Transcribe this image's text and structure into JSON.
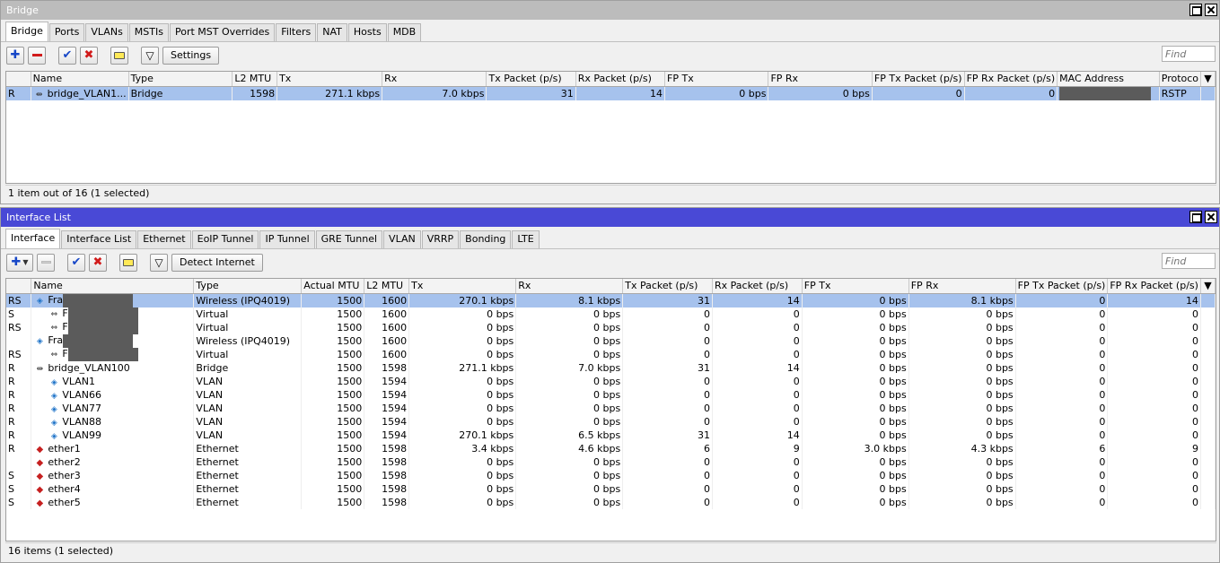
{
  "bridge_window": {
    "title": "Bridge",
    "tabs": [
      "Bridge",
      "Ports",
      "VLANs",
      "MSTIs",
      "Port MST Overrides",
      "Filters",
      "NAT",
      "Hosts",
      "MDB"
    ],
    "active_tab": "Bridge",
    "toolbar": {
      "settings_label": "Settings",
      "find_placeholder": "Find"
    },
    "columns": [
      "",
      "Name",
      "Type",
      "L2 MTU",
      "Tx",
      "Rx",
      "Tx Packet (p/s)",
      "Rx Packet (p/s)",
      "FP Tx",
      "FP Rx",
      "FP Tx Packet (p/s)",
      "FP Rx Packet (p/s)",
      "MAC Address",
      "Protoco"
    ],
    "rows": [
      {
        "flag": "R",
        "name": "bridge_VLAN1...",
        "type": "Bridge",
        "l2mtu": "1598",
        "tx": "271.1 kbps",
        "rx": "7.0 kbps",
        "txp": "31",
        "rxp": "14",
        "fptx": "0 bps",
        "fprx": "0 bps",
        "fptxp": "0",
        "fprxp": "0",
        "mac": "",
        "proto": "RSTP",
        "selected": true
      }
    ],
    "status": "1 item out of 16 (1 selected)"
  },
  "interface_window": {
    "title": "Interface List",
    "tabs": [
      "Interface",
      "Interface List",
      "Ethernet",
      "EoIP Tunnel",
      "IP Tunnel",
      "GRE Tunnel",
      "VLAN",
      "VRRP",
      "Bonding",
      "LTE"
    ],
    "active_tab": "Interface",
    "toolbar": {
      "detect_label": "Detect Internet",
      "find_placeholder": "Find"
    },
    "columns": [
      "",
      "Name",
      "Type",
      "Actual MTU",
      "L2 MTU",
      "Tx",
      "Rx",
      "Tx Packet (p/s)",
      "Rx Packet (p/s)",
      "FP Tx",
      "FP Rx",
      "FP Tx Packet (p/s)",
      "FP Rx Packet (p/s)"
    ],
    "rows": [
      {
        "flag": "RS",
        "icon": "wifi",
        "indent": 0,
        "name": "Fra",
        "type": "Wireless (IPQ4019)",
        "amtu": "1500",
        "l2mtu": "1600",
        "tx": "270.1 kbps",
        "rx": "8.1 kbps",
        "txp": "31",
        "rxp": "14",
        "fptx": "0 bps",
        "fprx": "8.1 kbps",
        "fptxp": "0",
        "fprxp": "14",
        "selected": true
      },
      {
        "flag": "S",
        "icon": "virtual",
        "indent": 1,
        "name": "F",
        "type": "Virtual",
        "amtu": "1500",
        "l2mtu": "1600",
        "tx": "0 bps",
        "rx": "0 bps",
        "txp": "0",
        "rxp": "0",
        "fptx": "0 bps",
        "fprx": "0 bps",
        "fptxp": "0",
        "fprxp": "0"
      },
      {
        "flag": "RS",
        "icon": "virtual",
        "indent": 1,
        "name": "F",
        "type": "Virtual",
        "amtu": "1500",
        "l2mtu": "1600",
        "tx": "0 bps",
        "rx": "0 bps",
        "txp": "0",
        "rxp": "0",
        "fptx": "0 bps",
        "fprx": "0 bps",
        "fptxp": "0",
        "fprxp": "0"
      },
      {
        "flag": "",
        "icon": "wifi",
        "indent": 0,
        "name": "Fra",
        "type": "Wireless (IPQ4019)",
        "amtu": "1500",
        "l2mtu": "1600",
        "tx": "0 bps",
        "rx": "0 bps",
        "txp": "0",
        "rxp": "0",
        "fptx": "0 bps",
        "fprx": "0 bps",
        "fptxp": "0",
        "fprxp": "0"
      },
      {
        "flag": "RS",
        "icon": "virtual",
        "indent": 1,
        "name": "F",
        "type": "Virtual",
        "amtu": "1500",
        "l2mtu": "1600",
        "tx": "0 bps",
        "rx": "0 bps",
        "txp": "0",
        "rxp": "0",
        "fptx": "0 bps",
        "fprx": "0 bps",
        "fptxp": "0",
        "fprxp": "0"
      },
      {
        "flag": "R",
        "icon": "bridge",
        "indent": 0,
        "name": "bridge_VLAN100",
        "type": "Bridge",
        "amtu": "1500",
        "l2mtu": "1598",
        "tx": "271.1 kbps",
        "rx": "7.0 kbps",
        "txp": "31",
        "rxp": "14",
        "fptx": "0 bps",
        "fprx": "0 bps",
        "fptxp": "0",
        "fprxp": "0"
      },
      {
        "flag": "R",
        "icon": "vlan",
        "indent": 1,
        "name": "VLAN1",
        "type": "VLAN",
        "amtu": "1500",
        "l2mtu": "1594",
        "tx": "0 bps",
        "rx": "0 bps",
        "txp": "0",
        "rxp": "0",
        "fptx": "0 bps",
        "fprx": "0 bps",
        "fptxp": "0",
        "fprxp": "0"
      },
      {
        "flag": "R",
        "icon": "vlan",
        "indent": 1,
        "name": "VLAN66",
        "type": "VLAN",
        "amtu": "1500",
        "l2mtu": "1594",
        "tx": "0 bps",
        "rx": "0 bps",
        "txp": "0",
        "rxp": "0",
        "fptx": "0 bps",
        "fprx": "0 bps",
        "fptxp": "0",
        "fprxp": "0"
      },
      {
        "flag": "R",
        "icon": "vlan",
        "indent": 1,
        "name": "VLAN77",
        "type": "VLAN",
        "amtu": "1500",
        "l2mtu": "1594",
        "tx": "0 bps",
        "rx": "0 bps",
        "txp": "0",
        "rxp": "0",
        "fptx": "0 bps",
        "fprx": "0 bps",
        "fptxp": "0",
        "fprxp": "0"
      },
      {
        "flag": "R",
        "icon": "vlan",
        "indent": 1,
        "name": "VLAN88",
        "type": "VLAN",
        "amtu": "1500",
        "l2mtu": "1594",
        "tx": "0 bps",
        "rx": "0 bps",
        "txp": "0",
        "rxp": "0",
        "fptx": "0 bps",
        "fprx": "0 bps",
        "fptxp": "0",
        "fprxp": "0"
      },
      {
        "flag": "R",
        "icon": "vlan",
        "indent": 1,
        "name": "VLAN99",
        "type": "VLAN",
        "amtu": "1500",
        "l2mtu": "1594",
        "tx": "270.1 kbps",
        "rx": "6.5 kbps",
        "txp": "31",
        "rxp": "14",
        "fptx": "0 bps",
        "fprx": "0 bps",
        "fptxp": "0",
        "fprxp": "0"
      },
      {
        "flag": "R",
        "icon": "ethernet",
        "indent": 0,
        "name": "ether1",
        "type": "Ethernet",
        "amtu": "1500",
        "l2mtu": "1598",
        "tx": "3.4 kbps",
        "rx": "4.6 kbps",
        "txp": "6",
        "rxp": "9",
        "fptx": "3.0 kbps",
        "fprx": "4.3 kbps",
        "fptxp": "6",
        "fprxp": "9"
      },
      {
        "flag": "",
        "icon": "ethernet",
        "indent": 0,
        "name": "ether2",
        "type": "Ethernet",
        "amtu": "1500",
        "l2mtu": "1598",
        "tx": "0 bps",
        "rx": "0 bps",
        "txp": "0",
        "rxp": "0",
        "fptx": "0 bps",
        "fprx": "0 bps",
        "fptxp": "0",
        "fprxp": "0"
      },
      {
        "flag": "S",
        "icon": "ethernet",
        "indent": 0,
        "name": "ether3",
        "type": "Ethernet",
        "amtu": "1500",
        "l2mtu": "1598",
        "tx": "0 bps",
        "rx": "0 bps",
        "txp": "0",
        "rxp": "0",
        "fptx": "0 bps",
        "fprx": "0 bps",
        "fptxp": "0",
        "fprxp": "0"
      },
      {
        "flag": "S",
        "icon": "ethernet",
        "indent": 0,
        "name": "ether4",
        "type": "Ethernet",
        "amtu": "1500",
        "l2mtu": "1598",
        "tx": "0 bps",
        "rx": "0 bps",
        "txp": "0",
        "rxp": "0",
        "fptx": "0 bps",
        "fprx": "0 bps",
        "fptxp": "0",
        "fprxp": "0"
      },
      {
        "flag": "S",
        "icon": "ethernet",
        "indent": 0,
        "name": "ether5",
        "type": "Ethernet",
        "amtu": "1500",
        "l2mtu": "1598",
        "tx": "0 bps",
        "rx": "0 bps",
        "txp": "0",
        "rxp": "0",
        "fptx": "0 bps",
        "fprx": "0 bps",
        "fptxp": "0",
        "fprxp": "0"
      }
    ],
    "status": "16 items (1 selected)"
  },
  "colors": {
    "bridge_title_bg": "#bcbcbc",
    "iface_title_bg": "#4949d6",
    "selection": "#a6c2ed"
  }
}
